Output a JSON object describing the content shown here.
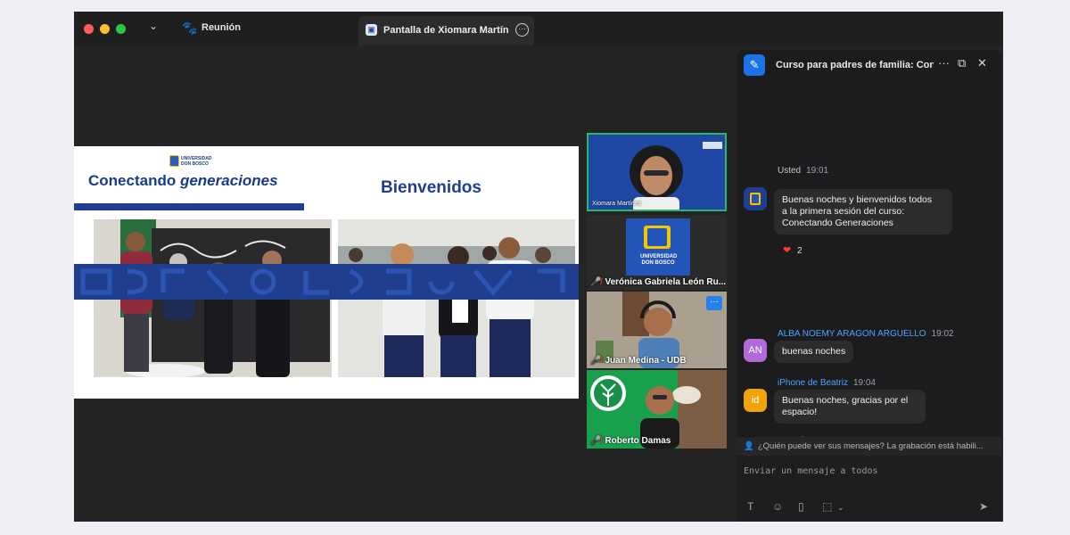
{
  "titlebar": {
    "meeting_label": "Reunión",
    "shared_tab_label": "Pantalla de Xiomara Martínez"
  },
  "slide": {
    "logo_text": "UNIVERSIDAD DON BOSCO",
    "title_bold": "Conectando ",
    "title_italic": "generaciones",
    "welcome": "Bienvenidos"
  },
  "participants": [
    {
      "name": "Xiomara Martínez",
      "muted": false
    },
    {
      "name": "Verónica Gabriela León Ru...",
      "muted": true,
      "logo_text": "UNIVERSIDAD DON BOSCO"
    },
    {
      "name": "Juan Medina - UDB",
      "muted": true
    },
    {
      "name": "Roberto Damas",
      "muted": true
    }
  ],
  "chat": {
    "title": "Curso para padres de familia: Con...",
    "messages": [
      {
        "sender": "Usted",
        "time": "19:01",
        "text_lines": [
          "Buenas noches y bienvenidos todos",
          "a la primera sesión del curso:",
          "Conectando Generaciones"
        ],
        "reaction": {
          "emoji": "heart",
          "count": "2"
        }
      },
      {
        "sender": "ALBA NOEMY ARAGON ARGUELLO",
        "time": "19:02",
        "avatar_initials": "AN",
        "avatar_color": "#b06ad9",
        "text_lines": [
          "buenas noches"
        ]
      },
      {
        "sender": "iPhone de Beatriz",
        "time": "19:04",
        "avatar_initials": "id",
        "avatar_color": "#f0a30a",
        "text_lines": [
          "Buenas noches, gracias por el",
          "espacio!"
        ]
      }
    ],
    "notice": "¿Quién puede ver sus mensajes? La grabación está habili...",
    "compose_placeholder": "Enviar un mensaje a todos"
  },
  "colors": {
    "zoom_blue": "#1a73e8",
    "udb_blue": "#1f3f8e",
    "mute_red": "#ff3b30"
  }
}
